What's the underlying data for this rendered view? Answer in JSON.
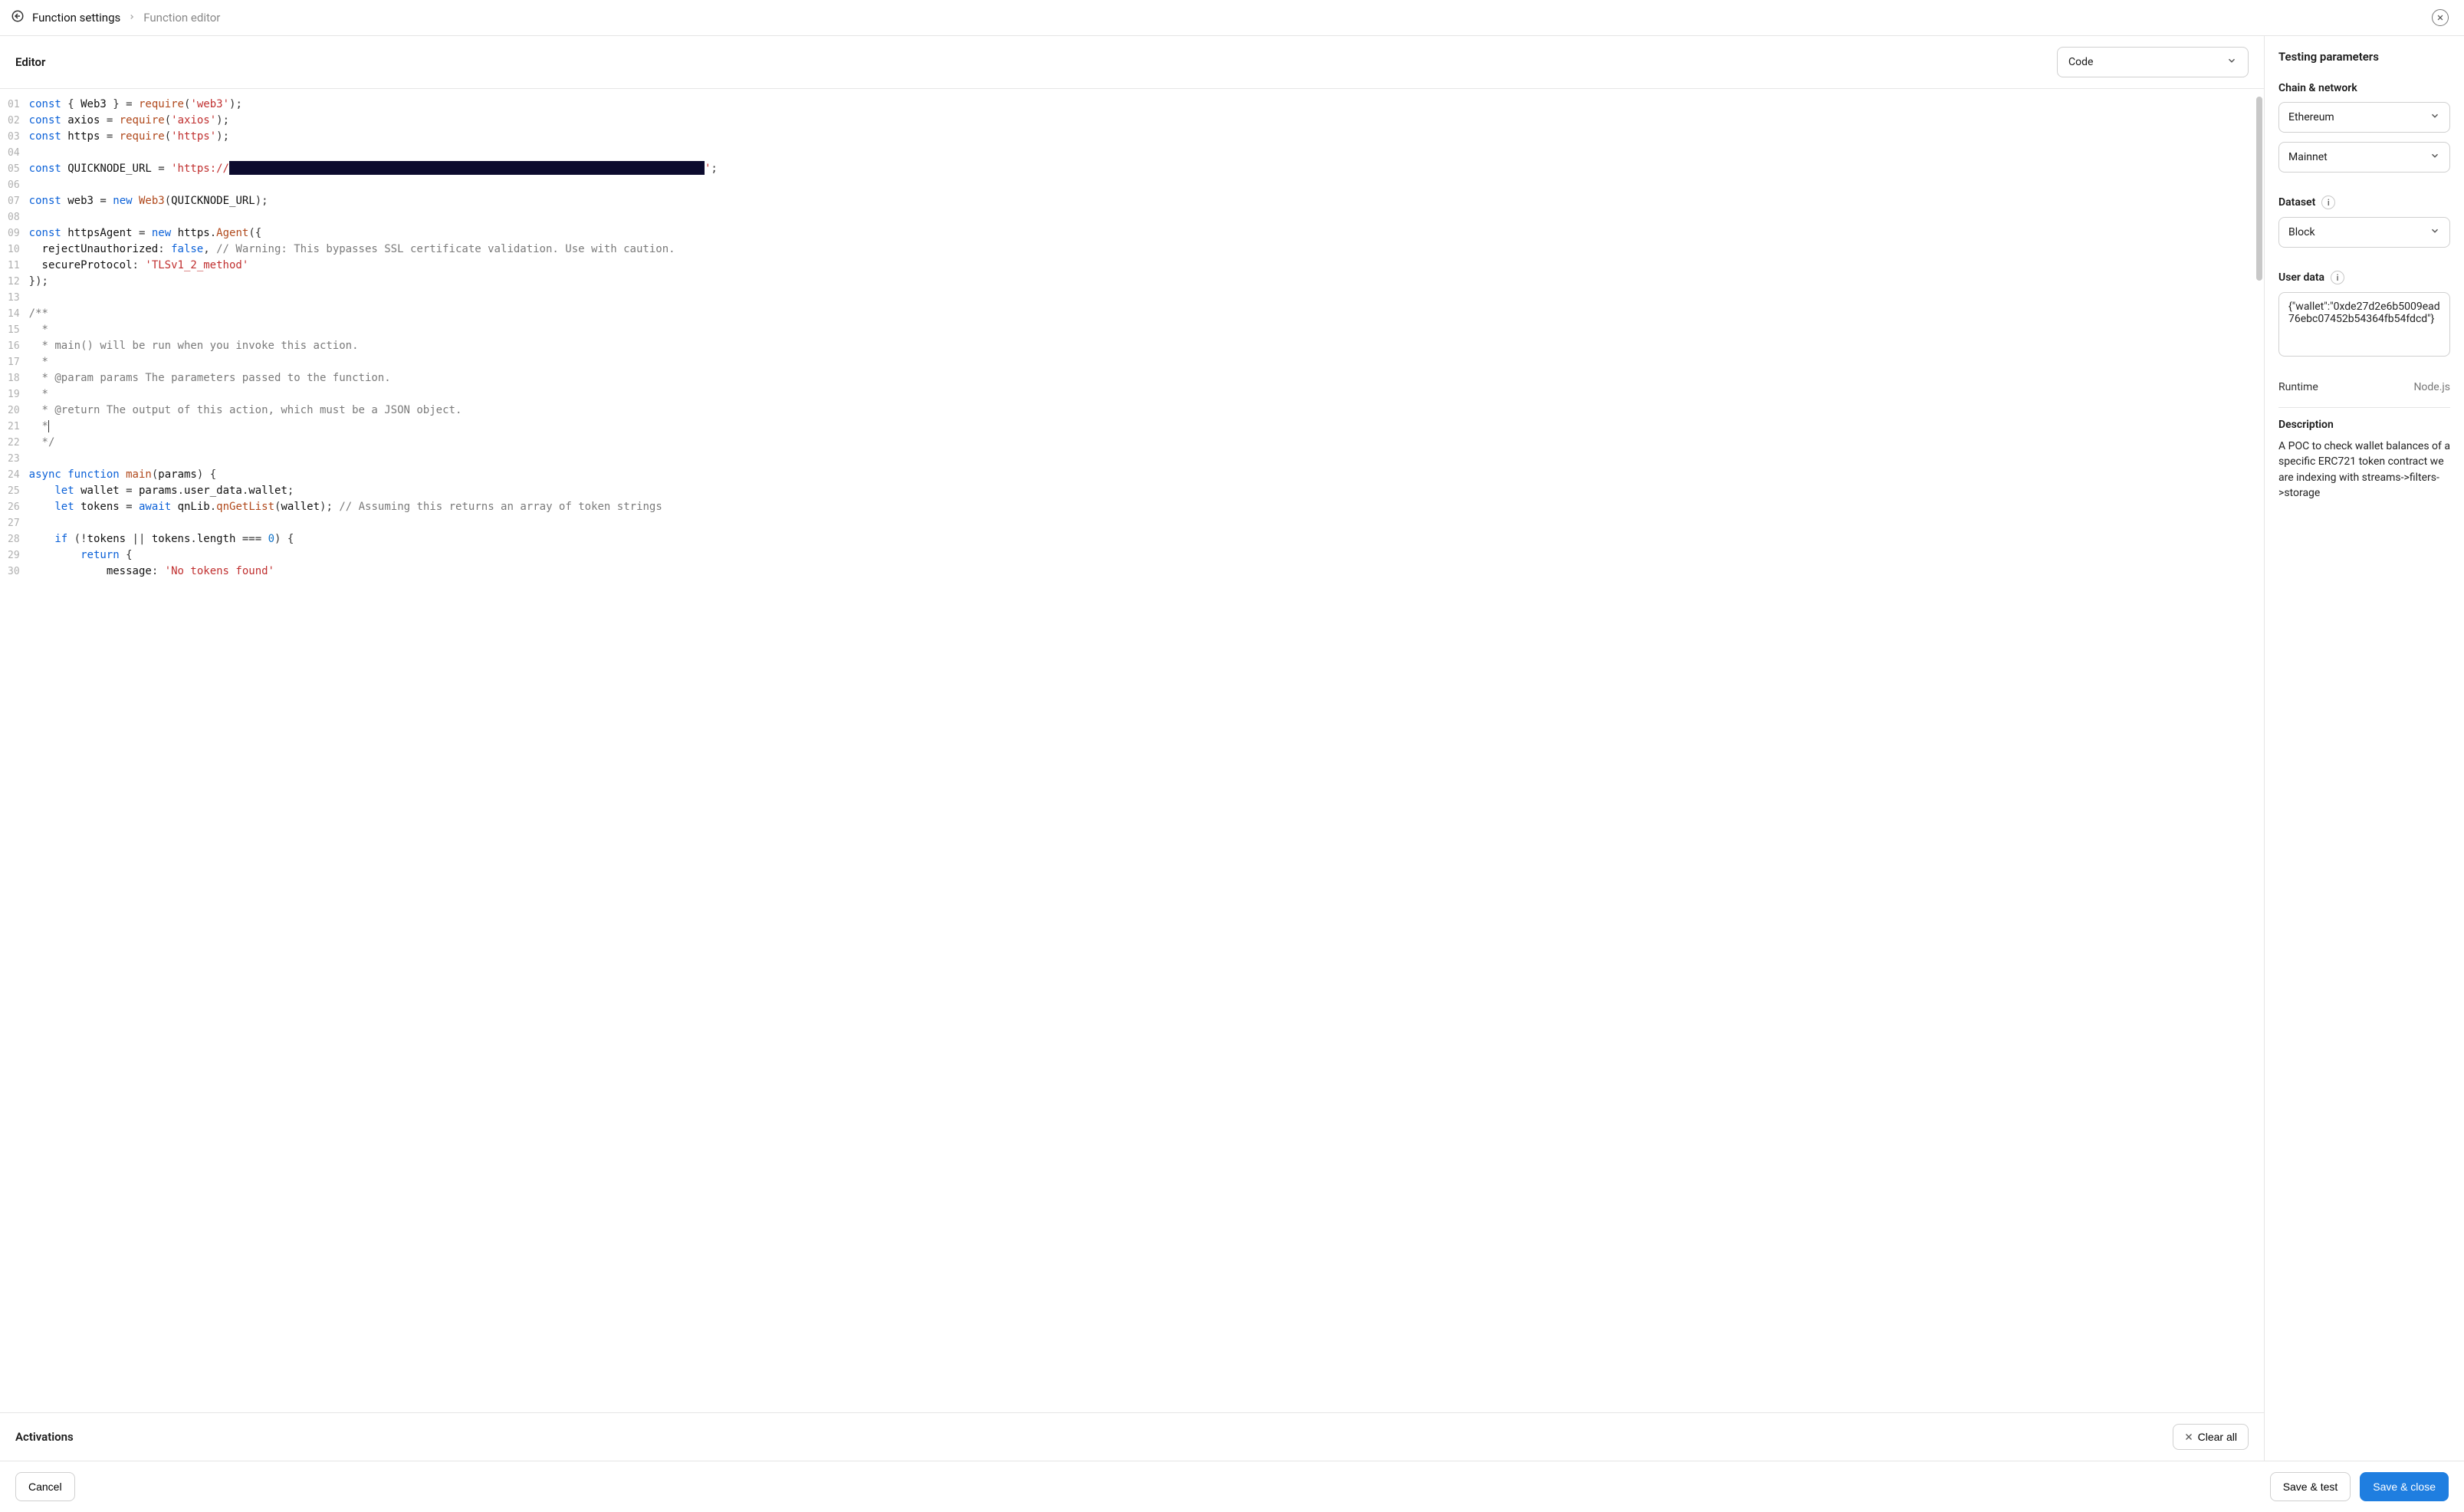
{
  "breadcrumb": {
    "back_label": "Function settings",
    "current_label": "Function editor"
  },
  "editor": {
    "title": "Editor",
    "view_select": "Code"
  },
  "code": {
    "lines": [
      {
        "n": "01",
        "tokens": [
          [
            "kw",
            "const"
          ],
          [
            "punc",
            " { "
          ],
          [
            "id",
            "Web3"
          ],
          [
            "punc",
            " } = "
          ],
          [
            "fn",
            "require"
          ],
          [
            "punc",
            "("
          ],
          [
            "str",
            "'web3'"
          ],
          [
            "punc",
            ");"
          ]
        ]
      },
      {
        "n": "02",
        "tokens": [
          [
            "kw",
            "const"
          ],
          [
            "punc",
            " "
          ],
          [
            "id",
            "axios"
          ],
          [
            "punc",
            " = "
          ],
          [
            "fn",
            "require"
          ],
          [
            "punc",
            "("
          ],
          [
            "str",
            "'axios'"
          ],
          [
            "punc",
            ");"
          ]
        ]
      },
      {
        "n": "03",
        "tokens": [
          [
            "kw",
            "const"
          ],
          [
            "punc",
            " "
          ],
          [
            "id",
            "https"
          ],
          [
            "punc",
            " = "
          ],
          [
            "fn",
            "require"
          ],
          [
            "punc",
            "("
          ],
          [
            "str",
            "'https'"
          ],
          [
            "punc",
            ");"
          ]
        ]
      },
      {
        "n": "04",
        "tokens": []
      },
      {
        "n": "05",
        "tokens": [
          [
            "kw",
            "const"
          ],
          [
            "punc",
            " "
          ],
          [
            "id",
            "QUICKNODE_URL"
          ],
          [
            "punc",
            " = "
          ],
          [
            "str",
            "'https://"
          ],
          [
            "redact",
            ""
          ],
          [
            "str",
            "'"
          ],
          [
            "punc",
            ";"
          ]
        ]
      },
      {
        "n": "06",
        "tokens": []
      },
      {
        "n": "07",
        "tokens": [
          [
            "kw",
            "const"
          ],
          [
            "punc",
            " "
          ],
          [
            "id",
            "web3"
          ],
          [
            "punc",
            " = "
          ],
          [
            "kw",
            "new"
          ],
          [
            "punc",
            " "
          ],
          [
            "type",
            "Web3"
          ],
          [
            "punc",
            "("
          ],
          [
            "id",
            "QUICKNODE_URL"
          ],
          [
            "punc",
            ");"
          ]
        ]
      },
      {
        "n": "08",
        "tokens": []
      },
      {
        "n": "09",
        "tokens": [
          [
            "kw",
            "const"
          ],
          [
            "punc",
            " "
          ],
          [
            "id",
            "httpsAgent"
          ],
          [
            "punc",
            " = "
          ],
          [
            "kw",
            "new"
          ],
          [
            "punc",
            " "
          ],
          [
            "id",
            "https"
          ],
          [
            "punc",
            "."
          ],
          [
            "type",
            "Agent"
          ],
          [
            "punc",
            "({"
          ]
        ]
      },
      {
        "n": "10",
        "tokens": [
          [
            "indent",
            "  "
          ],
          [
            "prop",
            "rejectUnauthorized"
          ],
          [
            "punc",
            ": "
          ],
          [
            "kw",
            "false"
          ],
          [
            "punc",
            ", "
          ],
          [
            "cm",
            "// Warning: This bypasses SSL certificate validation. Use with caution."
          ]
        ]
      },
      {
        "n": "11",
        "tokens": [
          [
            "indent",
            "  "
          ],
          [
            "prop",
            "secureProtocol"
          ],
          [
            "punc",
            ": "
          ],
          [
            "str",
            "'TLSv1_2_method'"
          ]
        ]
      },
      {
        "n": "12",
        "tokens": [
          [
            "punc",
            "});"
          ]
        ]
      },
      {
        "n": "13",
        "tokens": []
      },
      {
        "n": "14",
        "tokens": [
          [
            "cm",
            "/**"
          ]
        ]
      },
      {
        "n": "15",
        "tokens": [
          [
            "cm",
            "  *"
          ]
        ]
      },
      {
        "n": "16",
        "tokens": [
          [
            "cm",
            "  * main() will be run when you invoke this action."
          ]
        ]
      },
      {
        "n": "17",
        "tokens": [
          [
            "cm",
            "  *"
          ]
        ]
      },
      {
        "n": "18",
        "tokens": [
          [
            "cm",
            "  * @param params The parameters passed to the function."
          ]
        ]
      },
      {
        "n": "19",
        "tokens": [
          [
            "cm",
            "  *"
          ]
        ]
      },
      {
        "n": "20",
        "tokens": [
          [
            "cm",
            "  * @return The output of this action, which must be a JSON object."
          ]
        ]
      },
      {
        "n": "21",
        "tokens": [
          [
            "cm",
            "  *"
          ],
          [
            "caret",
            ""
          ]
        ]
      },
      {
        "n": "22",
        "tokens": [
          [
            "cm",
            "  */"
          ]
        ]
      },
      {
        "n": "23",
        "tokens": []
      },
      {
        "n": "24",
        "tokens": [
          [
            "kw",
            "async"
          ],
          [
            "punc",
            " "
          ],
          [
            "kw",
            "function"
          ],
          [
            "punc",
            " "
          ],
          [
            "fn",
            "main"
          ],
          [
            "punc",
            "("
          ],
          [
            "id",
            "params"
          ],
          [
            "punc",
            ") {"
          ]
        ]
      },
      {
        "n": "25",
        "tokens": [
          [
            "indent",
            "    "
          ],
          [
            "kw",
            "let"
          ],
          [
            "punc",
            " "
          ],
          [
            "id",
            "wallet"
          ],
          [
            "punc",
            " = "
          ],
          [
            "id",
            "params"
          ],
          [
            "punc",
            "."
          ],
          [
            "id",
            "user_data"
          ],
          [
            "punc",
            "."
          ],
          [
            "id",
            "wallet"
          ],
          [
            "punc",
            ";"
          ]
        ]
      },
      {
        "n": "26",
        "tokens": [
          [
            "indent",
            "    "
          ],
          [
            "kw",
            "let"
          ],
          [
            "punc",
            " "
          ],
          [
            "id",
            "tokens"
          ],
          [
            "punc",
            " = "
          ],
          [
            "kw",
            "await"
          ],
          [
            "punc",
            " "
          ],
          [
            "id",
            "qnLib"
          ],
          [
            "punc",
            "."
          ],
          [
            "fn",
            "qnGetList"
          ],
          [
            "punc",
            "("
          ],
          [
            "id",
            "wallet"
          ],
          [
            "punc",
            "); "
          ],
          [
            "cm",
            "// Assuming this returns an array of token strings"
          ]
        ]
      },
      {
        "n": "27",
        "tokens": []
      },
      {
        "n": "28",
        "tokens": [
          [
            "indent",
            "    "
          ],
          [
            "kw",
            "if"
          ],
          [
            "punc",
            " (!"
          ],
          [
            "id",
            "tokens"
          ],
          [
            "punc",
            " || "
          ],
          [
            "id",
            "tokens"
          ],
          [
            "punc",
            "."
          ],
          [
            "id",
            "length"
          ],
          [
            "punc",
            " === "
          ],
          [
            "num",
            "0"
          ],
          [
            "punc",
            ") {"
          ]
        ]
      },
      {
        "n": "29",
        "tokens": [
          [
            "indent",
            "        "
          ],
          [
            "kw",
            "return"
          ],
          [
            "punc",
            " {"
          ]
        ]
      },
      {
        "n": "30",
        "tokens": [
          [
            "indent",
            "            "
          ],
          [
            "prop",
            "message"
          ],
          [
            "punc",
            ": "
          ],
          [
            "str",
            "'No tokens found'"
          ]
        ]
      }
    ]
  },
  "activations": {
    "title": "Activations",
    "clear_label": "Clear all"
  },
  "sidebar": {
    "title": "Testing parameters",
    "chain_network_label": "Chain & network",
    "chain_value": "Ethereum",
    "network_value": "Mainnet",
    "dataset_label": "Dataset",
    "dataset_value": "Block",
    "userdata_label": "User data",
    "userdata_value": "{\"wallet\":\"0xde27d2e6b5009ead76ebc07452b54364fb54fdcd\"}",
    "runtime_label": "Runtime",
    "runtime_value": "Node.js",
    "description_label": "Description",
    "description_text": "A POC to check wallet balances of a specific ERC721 token contract we are indexing with streams->filters->storage"
  },
  "footer": {
    "cancel": "Cancel",
    "save_test": "Save & test",
    "save_close": "Save & close"
  }
}
